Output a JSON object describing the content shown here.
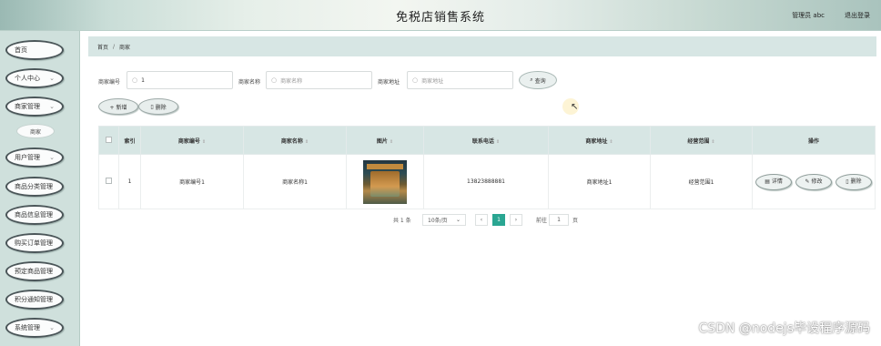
{
  "header": {
    "title": "免税店销售系统",
    "user": "管理员 abc",
    "logout": "退出登录"
  },
  "sidebar": {
    "items": [
      {
        "label": "首页"
      },
      {
        "label": "个人中心"
      },
      {
        "label": "商家管理"
      },
      {
        "label": "商家"
      },
      {
        "label": "用户管理"
      },
      {
        "label": "商品分类管理"
      },
      {
        "label": "商品信息管理"
      },
      {
        "label": "购买订单管理"
      },
      {
        "label": "预定商品管理"
      },
      {
        "label": "积分通知管理"
      },
      {
        "label": "系统管理"
      }
    ]
  },
  "breadcrumb": {
    "home": "首页",
    "separator": "/",
    "current": "商家"
  },
  "filters": {
    "merchant_no": {
      "label": "商家编号",
      "value": "1"
    },
    "merchant_name": {
      "label": "商家名称",
      "placeholder": "商家名称"
    },
    "merchant_addr": {
      "label": "商家地址",
      "placeholder": "商家地址"
    },
    "query_label": "查询",
    "search_icon": "search-icon"
  },
  "actions": {
    "add": "+ 新增",
    "delete": "删除"
  },
  "table": {
    "headers": [
      "",
      "索引",
      "商家编号",
      "商家名称",
      "图片",
      "联系电话",
      "商家地址",
      "经营范围",
      "操作"
    ],
    "rows": [
      {
        "index": "1",
        "merchant_no": "商家编号1",
        "merchant_name": "商家名称1",
        "phone": "13823888881",
        "address": "商家地址1",
        "scope": "经营范围1",
        "btn_detail": "详情",
        "btn_edit": "修改",
        "btn_delete": "删除"
      }
    ]
  },
  "pagination": {
    "total": "共 1 条",
    "page_size": "10条/页",
    "current_page": "1",
    "goto_label": "前往",
    "goto_value": "1",
    "page_suffix": "页",
    "prev": "‹",
    "next": "›",
    "active_color": "#2aa692"
  },
  "watermark": "CSDN @nodejs毕设程序源码"
}
